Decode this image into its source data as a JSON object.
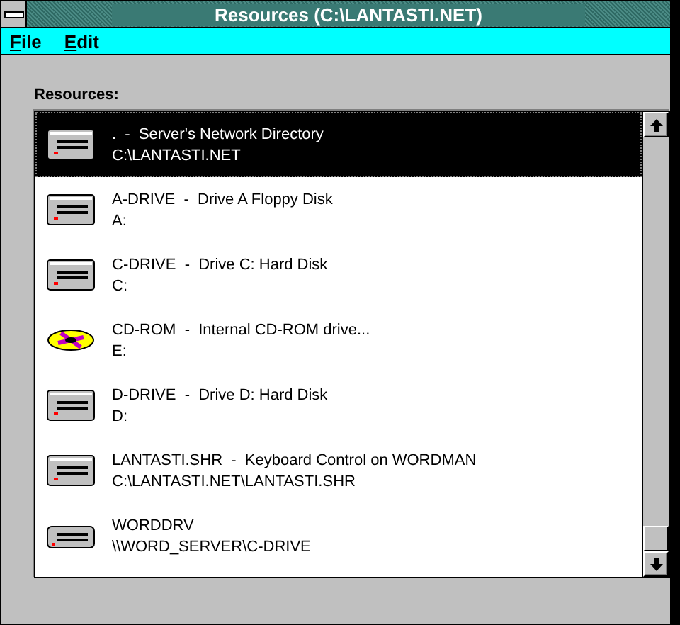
{
  "window": {
    "title": "Resources (C:\\LANTASTI.NET)"
  },
  "menu": [
    "File",
    "Edit"
  ],
  "list_label": "Resources:",
  "resources": [
    {
      "kind": "drive",
      "label": ".  -  Server's Network Directory",
      "path": "C:\\LANTASTI.NET",
      "selected": true
    },
    {
      "kind": "drive",
      "label": "A-DRIVE  -  Drive A Floppy Disk",
      "path": "A:",
      "selected": false
    },
    {
      "kind": "drive",
      "label": "C-DRIVE  -  Drive C: Hard Disk",
      "path": "C:",
      "selected": false
    },
    {
      "kind": "cdrom",
      "label": "CD-ROM  -  Internal CD-ROM drive...",
      "path": "E:",
      "selected": false
    },
    {
      "kind": "drive",
      "label": "D-DRIVE  -  Drive D: Hard Disk",
      "path": "D:",
      "selected": false
    },
    {
      "kind": "drive",
      "label": "LANTASTI.SHR  -  Keyboard Control on WORDMAN",
      "path": "C:\\LANTASTI.NET\\LANTASTI.SHR",
      "selected": false
    },
    {
      "kind": "network",
      "label": "WORDDRV",
      "path": "\\\\WORD_SERVER\\C-DRIVE",
      "selected": false
    }
  ]
}
